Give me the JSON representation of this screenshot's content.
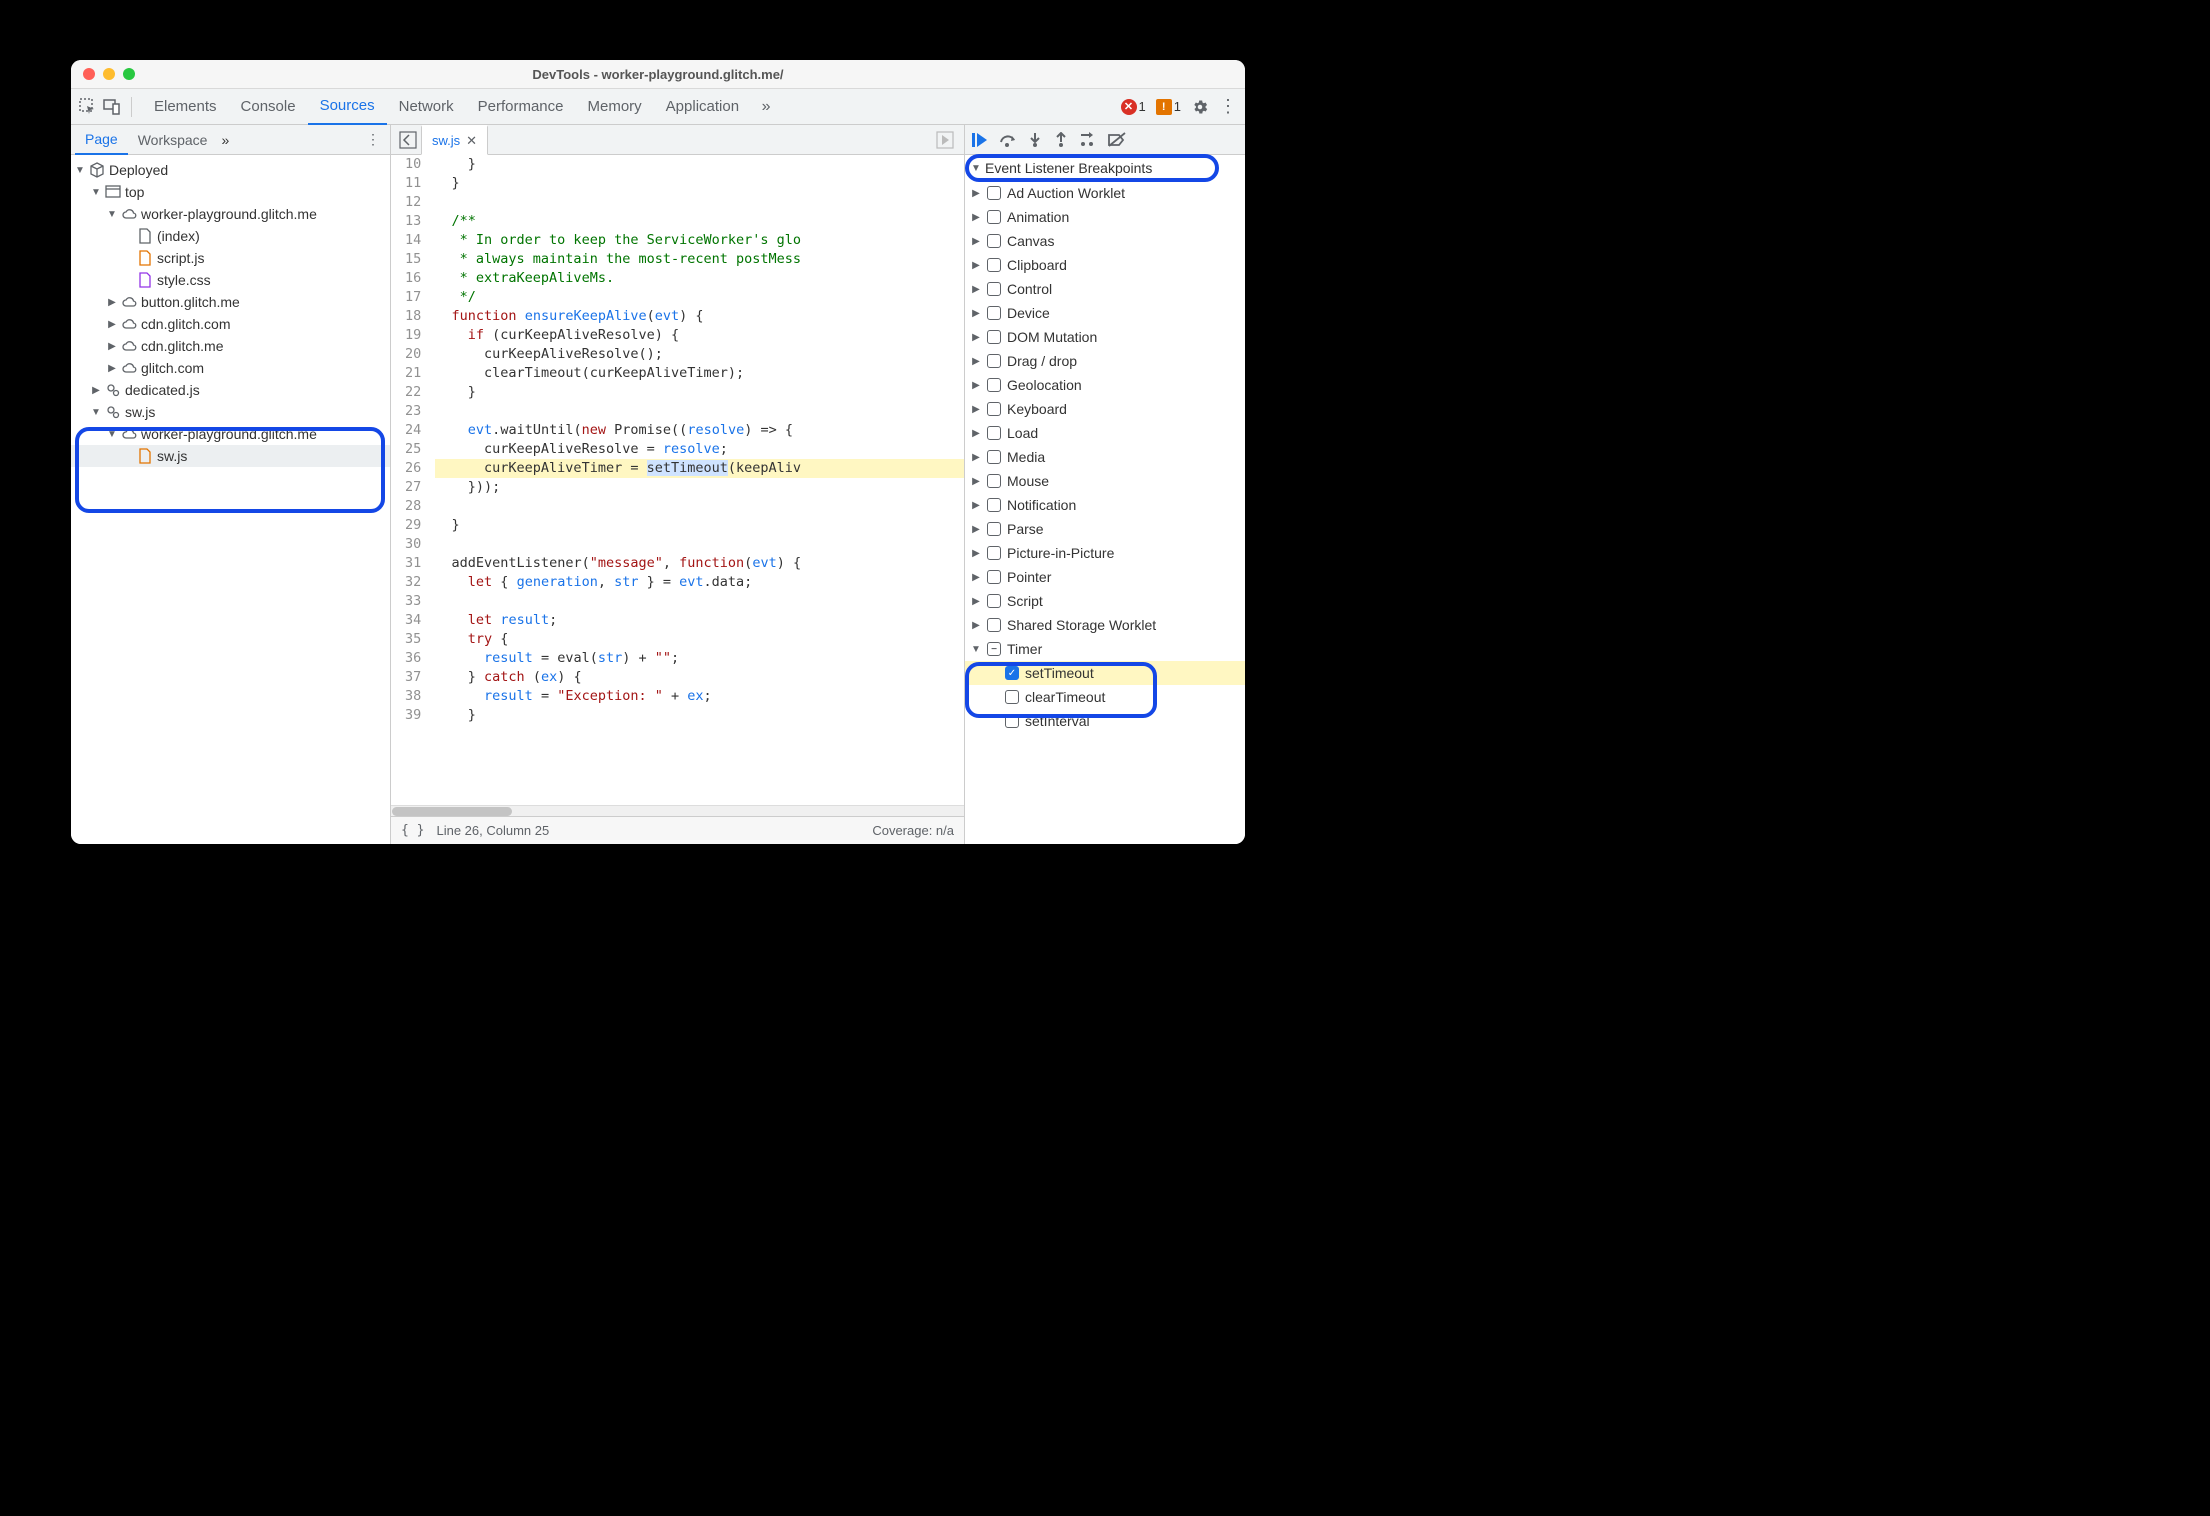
{
  "window": {
    "title": "DevTools - worker-playground.glitch.me/"
  },
  "tabs": {
    "items": [
      "Elements",
      "Console",
      "Sources",
      "Network",
      "Performance",
      "Memory",
      "Application"
    ],
    "active": "Sources",
    "errors": "1",
    "warnings": "1"
  },
  "leftTabs": {
    "items": [
      "Page",
      "Workspace"
    ],
    "active": "Page"
  },
  "tree": [
    {
      "depth": 0,
      "arrow": "▼",
      "icon": "cube",
      "label": "Deployed"
    },
    {
      "depth": 1,
      "arrow": "▼",
      "icon": "frame",
      "label": "top"
    },
    {
      "depth": 2,
      "arrow": "▼",
      "icon": "cloud",
      "label": "worker-playground.glitch.me"
    },
    {
      "depth": 3,
      "arrow": "",
      "icon": "doc",
      "label": "(index)"
    },
    {
      "depth": 3,
      "arrow": "",
      "icon": "doc-js",
      "label": "script.js"
    },
    {
      "depth": 3,
      "arrow": "",
      "icon": "doc-css",
      "label": "style.css"
    },
    {
      "depth": 2,
      "arrow": "▶",
      "icon": "cloud",
      "label": "button.glitch.me"
    },
    {
      "depth": 2,
      "arrow": "▶",
      "icon": "cloud",
      "label": "cdn.glitch.com"
    },
    {
      "depth": 2,
      "arrow": "▶",
      "icon": "cloud",
      "label": "cdn.glitch.me"
    },
    {
      "depth": 2,
      "arrow": "▶",
      "icon": "cloud",
      "label": "glitch.com"
    },
    {
      "depth": 1,
      "arrow": "▶",
      "icon": "gears",
      "label": "dedicated.js"
    },
    {
      "depth": 1,
      "arrow": "▼",
      "icon": "gears",
      "label": "sw.js"
    },
    {
      "depth": 2,
      "arrow": "▼",
      "icon": "cloud",
      "label": "worker-playground.glitch.me"
    },
    {
      "depth": 3,
      "arrow": "",
      "icon": "doc-js",
      "label": "sw.js",
      "selected": true
    }
  ],
  "editor": {
    "file": "sw.js",
    "firstLine": 10,
    "highlightLine": 26,
    "lines": [
      "    }",
      "  }",
      "",
      "  /**",
      "   * In order to keep the ServiceWorker's glo",
      "   * always maintain the most-recent postMess",
      "   * extraKeepAliveMs.",
      "   */",
      "  function ensureKeepAlive(evt) {",
      "    if (curKeepAliveResolve) {",
      "      curKeepAliveResolve();",
      "      clearTimeout(curKeepAliveTimer);",
      "    }",
      "",
      "    evt.waitUntil(new Promise((resolve) => {",
      "      curKeepAliveResolve = resolve;",
      "      curKeepAliveTimer = setTimeout(keepAliv",
      "    }));",
      "",
      "  }",
      "",
      "  addEventListener(\"message\", function(evt) {",
      "    let { generation, str } = evt.data;",
      "",
      "    let result;",
      "    try {",
      "      result = eval(str) + \"\";",
      "    } catch (ex) {",
      "      result = \"Exception: \" + ex;",
      "    }"
    ],
    "status": {
      "pos": "Line 26, Column 25",
      "coverage": "Coverage: n/a"
    }
  },
  "eventListenerHeader": "Event Listener Breakpoints",
  "bpCategories": [
    {
      "label": "Ad Auction Worklet",
      "check": ""
    },
    {
      "label": "Animation",
      "check": ""
    },
    {
      "label": "Canvas",
      "check": ""
    },
    {
      "label": "Clipboard",
      "check": ""
    },
    {
      "label": "Control",
      "check": ""
    },
    {
      "label": "Device",
      "check": ""
    },
    {
      "label": "DOM Mutation",
      "check": ""
    },
    {
      "label": "Drag / drop",
      "check": ""
    },
    {
      "label": "Geolocation",
      "check": ""
    },
    {
      "label": "Keyboard",
      "check": ""
    },
    {
      "label": "Load",
      "check": ""
    },
    {
      "label": "Media",
      "check": ""
    },
    {
      "label": "Mouse",
      "check": ""
    },
    {
      "label": "Notification",
      "check": ""
    },
    {
      "label": "Parse",
      "check": ""
    },
    {
      "label": "Picture-in-Picture",
      "check": ""
    },
    {
      "label": "Pointer",
      "check": ""
    },
    {
      "label": "Script",
      "check": ""
    },
    {
      "label": "Shared Storage Worklet",
      "check": ""
    }
  ],
  "timerGroup": {
    "label": "Timer",
    "children": [
      {
        "label": "setTimeout",
        "checked": true,
        "hl": true
      },
      {
        "label": "clearTimeout",
        "checked": false
      },
      {
        "label": "setInterval",
        "checked": false
      }
    ]
  }
}
